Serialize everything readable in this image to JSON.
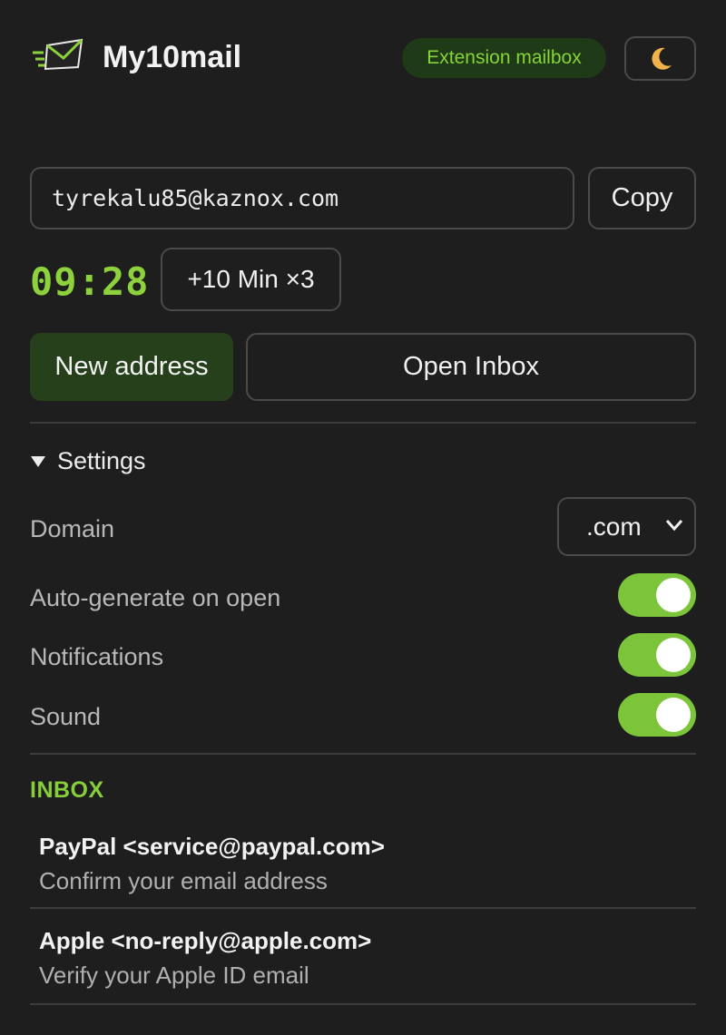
{
  "app": {
    "name": "My10mail",
    "badge": "Extension mailbox",
    "theme_icon": "moon-icon",
    "accent_color": "#8dd13c"
  },
  "address": {
    "email": "tyrekalu85@kaznox.com",
    "copy_label": "Copy"
  },
  "timer": {
    "value": "09:28",
    "extend_label": "+10 Min ×3"
  },
  "actions": {
    "new_address_label": "New address",
    "open_inbox_label": "Open Inbox"
  },
  "settings": {
    "header": "Settings",
    "domain_label": "Domain",
    "domain_value": ".com",
    "toggles": [
      {
        "label": "Auto-generate on open",
        "on": true
      },
      {
        "label": "Notifications",
        "on": true
      },
      {
        "label": "Sound",
        "on": true
      }
    ]
  },
  "inbox": {
    "title": "INBOX",
    "messages": [
      {
        "from": "PayPal <service@paypal.com>",
        "subject": "Confirm your email address"
      },
      {
        "from": "Apple <no-reply@apple.com>",
        "subject": "Verify your Apple ID email"
      }
    ]
  }
}
